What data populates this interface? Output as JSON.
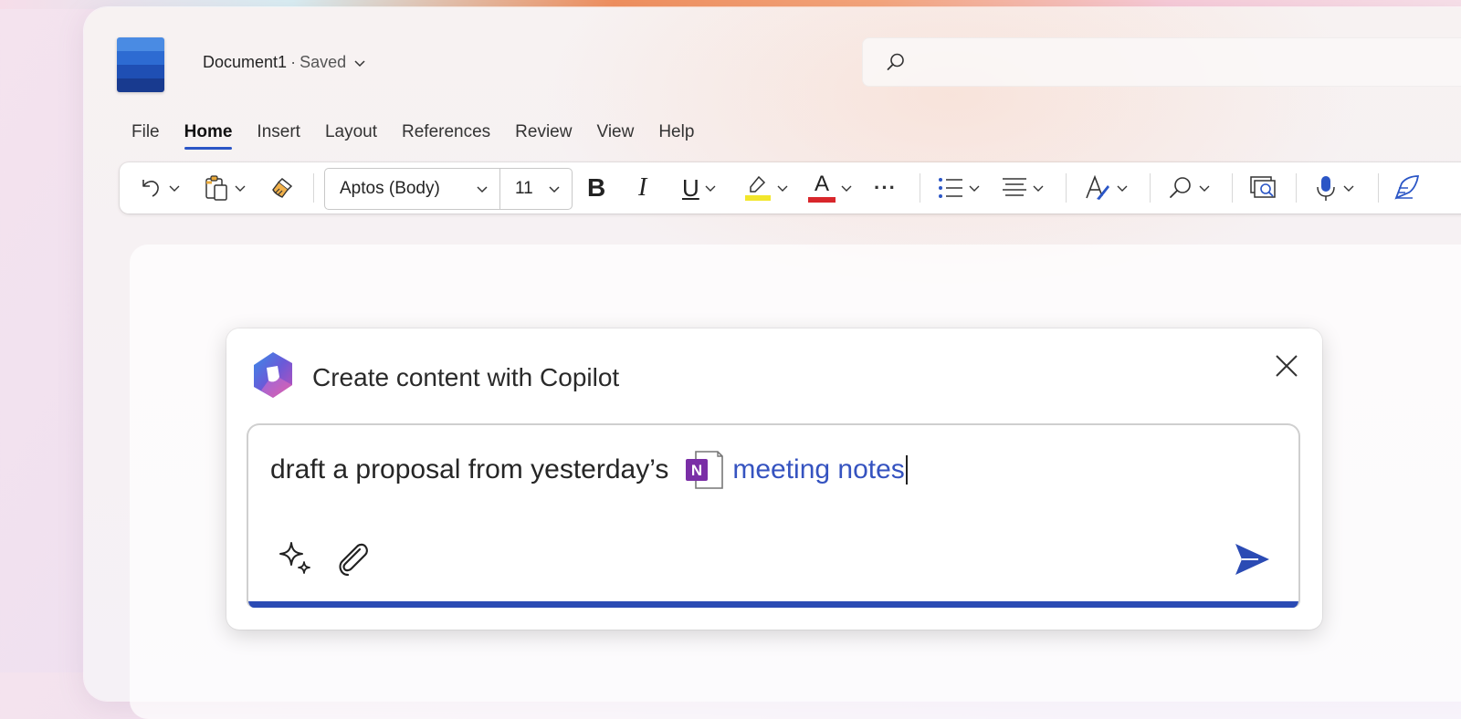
{
  "document": {
    "name": "Document1",
    "status": "Saved",
    "separator": "·"
  },
  "search": {
    "placeholder": ""
  },
  "tabs": [
    {
      "label": "File"
    },
    {
      "label": "Home",
      "active": true
    },
    {
      "label": "Insert"
    },
    {
      "label": "Layout"
    },
    {
      "label": "References"
    },
    {
      "label": "Review"
    },
    {
      "label": "View"
    },
    {
      "label": "Help"
    }
  ],
  "ribbon": {
    "font_name": "Aptos (Body)",
    "font_size": "11",
    "bold_label": "B",
    "italic_label": "I",
    "underline_label": "U",
    "font_color_label": "A",
    "more_label": "···",
    "highlight_color": "#f2e62b",
    "font_color": "#d8262b"
  },
  "copilot": {
    "title": "Create content with Copilot",
    "prompt_text": "draft a proposal from yesterday’s",
    "mention_text": "meeting notes",
    "mention_icon": "onenote-icon",
    "accent_color": "#2b4bb4"
  },
  "colors": {
    "accent": "#2b56c6",
    "word_blue_1": "#4a8be3",
    "word_blue_2": "#2d6bd2",
    "word_blue_3": "#1f4fb4",
    "word_blue_4": "#183a8f",
    "onenote_purple": "#7a2ea6"
  }
}
